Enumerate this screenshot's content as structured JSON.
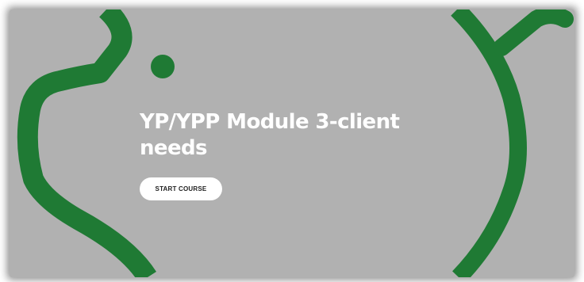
{
  "course": {
    "title": "YP/YPP Module 3-client needs",
    "start_button_label": "START COURSE"
  },
  "colors": {
    "banner_background": "#b1b1b1",
    "accent_green": "#1f7a34",
    "title_text": "#ffffff",
    "button_background": "#ffffff",
    "button_text": "#222222"
  }
}
